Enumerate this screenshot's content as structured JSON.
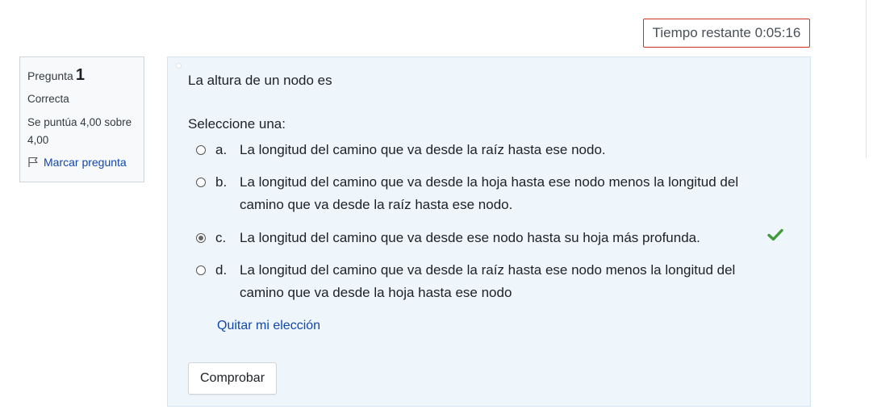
{
  "timer": {
    "label": "Tiempo restante",
    "value": "0:05:16"
  },
  "question_info": {
    "label": "Pregunta",
    "number": "1",
    "state": "Correcta",
    "grade": "Se puntúa 4,00 sobre 4,00",
    "flag_label": "Marcar pregunta"
  },
  "question": {
    "text": "La altura de un nodo es",
    "prompt": "Seleccione una:",
    "answers": [
      {
        "letter": "a.",
        "text": "La longitud del camino que va desde la raíz hasta ese nodo.",
        "selected": false
      },
      {
        "letter": "b.",
        "text": "La longitud del camino que va desde la hoja hasta ese nodo menos la longitud del camino que va desde la raíz hasta ese nodo.",
        "selected": false
      },
      {
        "letter": "c.",
        "text": "La longitud del camino que va desde ese nodo hasta su hoja más profunda.",
        "selected": true,
        "correct": true
      },
      {
        "letter": "d.",
        "text": "La longitud del camino que va desde la raíz hasta ese nodo menos la longitud del camino que va desde la hoja hasta ese nodo",
        "selected": false
      }
    ],
    "clear_choice": "Quitar mi elección",
    "check_button": "Comprobar"
  },
  "colors": {
    "link": "#0f47ad",
    "correct": "#357a32",
    "timer_border": "#ca3120",
    "panel_bg": "#eef6fb"
  },
  "icons": {
    "flag": "flag-icon",
    "correct": "check-icon"
  }
}
